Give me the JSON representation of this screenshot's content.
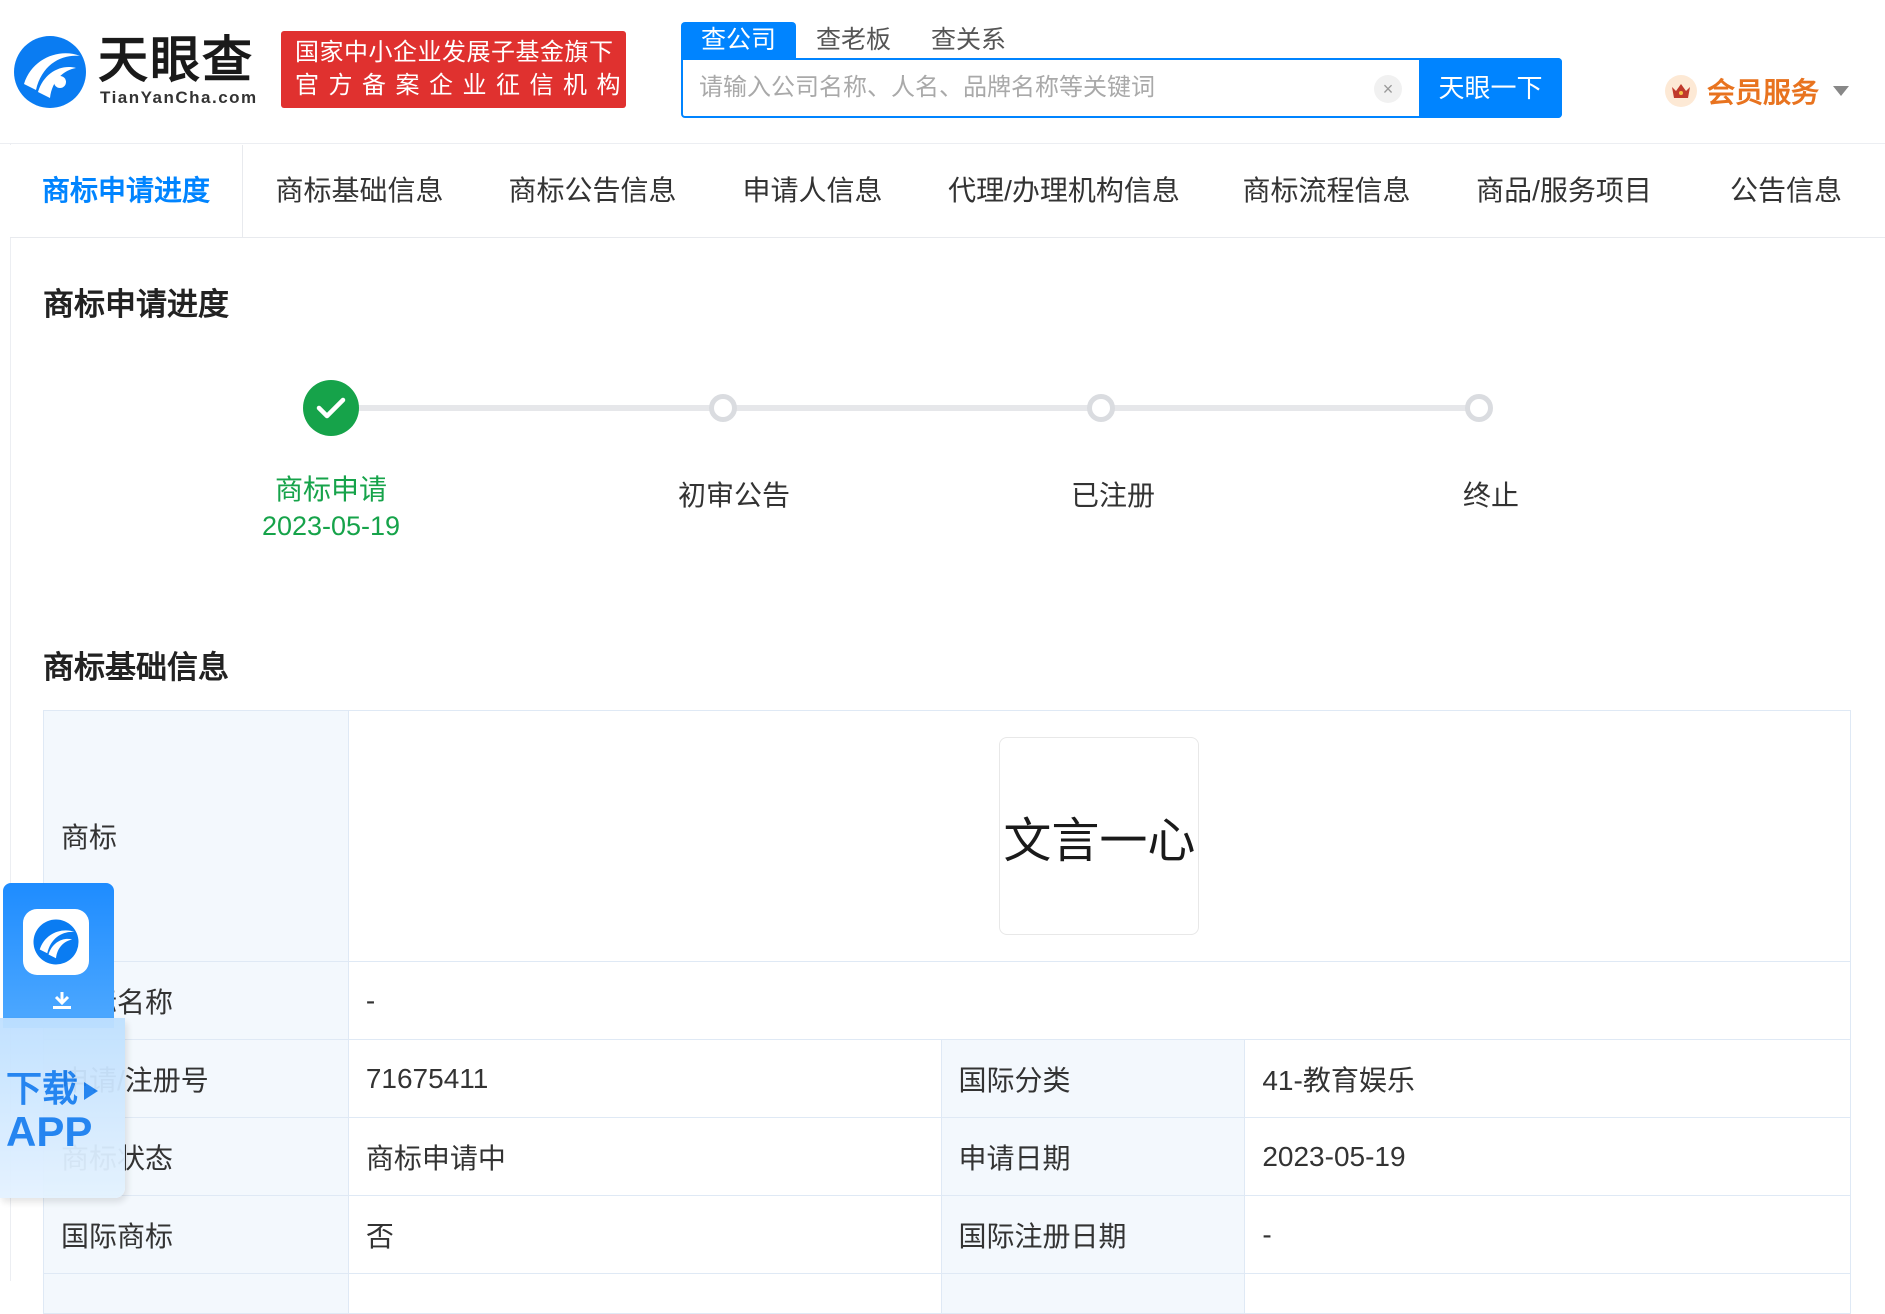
{
  "header": {
    "logo_cn": "天眼查",
    "logo_en": "TianYanCha.com",
    "badge_line1": "国家中小企业发展子基金旗下",
    "badge_line2": "官方备案企业征信机构",
    "search_tabs": [
      "查公司",
      "查老板",
      "查关系"
    ],
    "search_placeholder": "请输入公司名称、人名、品牌名称等关键词",
    "clear_icon": "×",
    "search_button": "天眼一下",
    "vip_label": "会员服务"
  },
  "nav": {
    "tabs": [
      "商标申请进度",
      "商标基础信息",
      "商标公告信息",
      "申请人信息",
      "代理/办理机构信息",
      "商标流程信息",
      "商品/服务项目",
      "公告信息"
    ]
  },
  "progress": {
    "title": "商标申请进度",
    "steps": [
      {
        "label": "商标申请",
        "date": "2023-05-19",
        "done": true
      },
      {
        "label": "初审公告",
        "date": "",
        "done": false
      },
      {
        "label": "已注册",
        "date": "",
        "done": false
      },
      {
        "label": "终止",
        "date": "",
        "done": false
      }
    ]
  },
  "basic": {
    "title": "商标基础信息",
    "trademark_key": "商标",
    "trademark_text": "文言一心",
    "name_key": "商标名称",
    "name_value": "-",
    "reg_no_key": "申请/注册号",
    "reg_no_value": "71675411",
    "intl_class_key": "国际分类",
    "intl_class_value": "41-教育娱乐",
    "status_key": "商标状态",
    "status_value": "商标申请中",
    "apply_date_key": "申请日期",
    "apply_date_value": "2023-05-19",
    "intl_tm_key": "国际商标",
    "intl_tm_value": "否",
    "intl_reg_date_key": "国际注册日期",
    "intl_reg_date_value": "-"
  },
  "float_app": {
    "line1": "下载",
    "line2": "APP"
  },
  "colors": {
    "primary": "#0084ff",
    "badge_red": "#e0312f",
    "success": "#16a34a",
    "vip": "#e8731f"
  }
}
